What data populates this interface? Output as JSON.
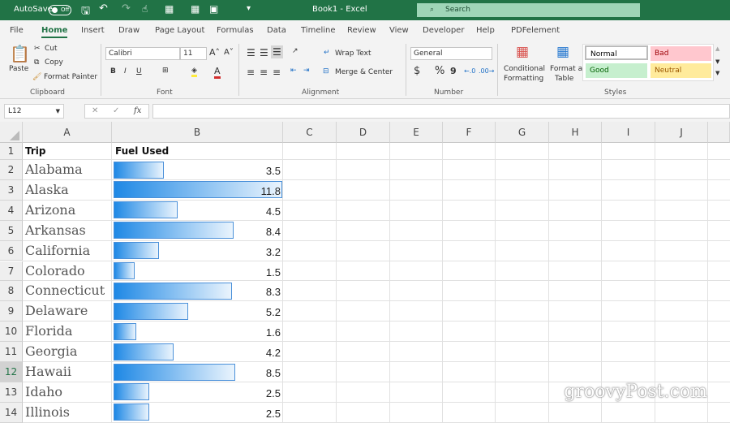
{
  "titlebar": {
    "autosave": "AutoSave",
    "autosave_state": "Off",
    "title": "Book1 - Excel",
    "search_placeholder": "Search"
  },
  "tabs": [
    "File",
    "Home",
    "Insert",
    "Draw",
    "Page Layout",
    "Formulas",
    "Data",
    "Timeline",
    "Review",
    "View",
    "Developer",
    "Help",
    "PDFelement"
  ],
  "active_tab": "Home",
  "ribbon": {
    "paste": "Paste",
    "cut": "Cut",
    "copy": "Copy",
    "format_painter": "Format Painter",
    "clipboard": "Clipboard",
    "font_name": "Calibri",
    "font_size": "11",
    "font": "Font",
    "bold": "B",
    "italic": "I",
    "underline": "U",
    "wrap_text": "Wrap Text",
    "merge_center": "Merge & Center",
    "alignment": "Alignment",
    "number_format": "General",
    "currency": "$",
    "percent": "%",
    "comma": "9",
    "number": "Number",
    "conditional_formatting_1": "Conditional",
    "conditional_formatting_2": "Formatting",
    "format_table_1": "Format as",
    "format_table_2": "Table",
    "styles": "Styles",
    "style_normal": "Normal",
    "style_bad": "Bad",
    "style_good": "Good",
    "style_neutral": "Neutral"
  },
  "formula_bar": {
    "name_box": "L12",
    "fx": "fx",
    "cancel": "✕",
    "enter": "✓",
    "formula": ""
  },
  "columns": [
    "A",
    "B",
    "C",
    "D",
    "E",
    "F",
    "G",
    "H",
    "I",
    "J"
  ],
  "headers": {
    "trip": "Trip",
    "fuel": "Fuel Used"
  },
  "rows": [
    {
      "n": "1"
    },
    {
      "n": "2",
      "trip": "Alabama",
      "fuel": "3.5",
      "v": 3.5
    },
    {
      "n": "3",
      "trip": "Alaska",
      "fuel": "11.8",
      "v": 11.8
    },
    {
      "n": "4",
      "trip": "Arizona",
      "fuel": "4.5",
      "v": 4.5
    },
    {
      "n": "5",
      "trip": "Arkansas",
      "fuel": "8.4",
      "v": 8.4
    },
    {
      "n": "6",
      "trip": "California",
      "fuel": "3.2",
      "v": 3.2
    },
    {
      "n": "7",
      "trip": "Colorado",
      "fuel": "1.5",
      "v": 1.5
    },
    {
      "n": "8",
      "trip": "Connecticut",
      "fuel": "8.3",
      "v": 8.3
    },
    {
      "n": "9",
      "trip": "Delaware",
      "fuel": "5.2",
      "v": 5.2
    },
    {
      "n": "10",
      "trip": "Florida",
      "fuel": "1.6",
      "v": 1.6
    },
    {
      "n": "11",
      "trip": "Georgia",
      "fuel": "4.2",
      "v": 4.2
    },
    {
      "n": "12",
      "trip": "Hawaii",
      "fuel": "8.5",
      "v": 8.5
    },
    {
      "n": "13",
      "trip": "Idaho",
      "fuel": "2.5",
      "v": 2.5
    },
    {
      "n": "14",
      "trip": "Illinois",
      "fuel": "2.5",
      "v": 2.5
    }
  ],
  "data_bar_max": 11.8,
  "data_bar_color": "#1e88e5",
  "accent": "#217346",
  "watermark": "groovyPost.com"
}
